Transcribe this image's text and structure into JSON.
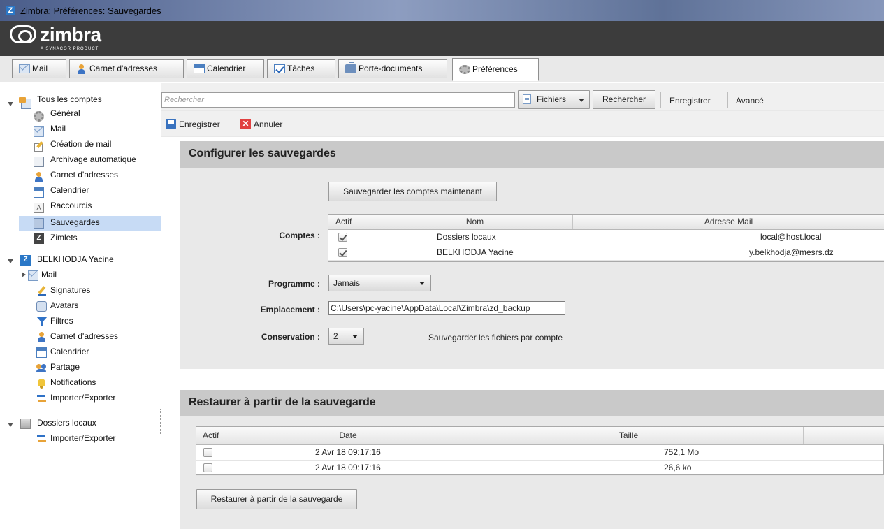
{
  "window": {
    "title": "Zimbra: Préférences: Sauvegardes"
  },
  "brand": {
    "name": "zimbra",
    "tagline": "A SYNACOR PRODUCT"
  },
  "tabs": [
    {
      "label": "Mail",
      "icon": "mail-icon"
    },
    {
      "label": "Carnet d'adresses",
      "icon": "contacts-icon"
    },
    {
      "label": "Calendrier",
      "icon": "calendar-icon"
    },
    {
      "label": "Tâches",
      "icon": "tasks-icon"
    },
    {
      "label": "Porte-documents",
      "icon": "briefcase-icon"
    },
    {
      "label": "Préférences",
      "icon": "gear-icon",
      "active": true
    }
  ],
  "sidebar": {
    "all_accounts": {
      "label": "Tous les comptes",
      "items": [
        {
          "label": "Général",
          "icon": "gear-icon"
        },
        {
          "label": "Mail",
          "icon": "mail-icon"
        },
        {
          "label": "Création de mail",
          "icon": "compose-icon"
        },
        {
          "label": "Archivage automatique",
          "icon": "archive-icon"
        },
        {
          "label": "Carnet d'adresses",
          "icon": "contacts-icon"
        },
        {
          "label": "Calendrier",
          "icon": "calendar-icon"
        },
        {
          "label": "Raccourcis",
          "icon": "shortcut-icon"
        },
        {
          "label": "Sauvegardes",
          "icon": "backup-icon",
          "selected": true
        },
        {
          "label": "Zimlets",
          "icon": "zimlet-icon"
        }
      ]
    },
    "user_account": {
      "label": "BELKHODJA Yacine",
      "items": [
        {
          "label": "Mail",
          "icon": "mail-icon"
        },
        {
          "label": "Signatures",
          "icon": "signature-icon"
        },
        {
          "label": "Avatars",
          "icon": "avatar-icon"
        },
        {
          "label": "Filtres",
          "icon": "filter-icon"
        },
        {
          "label": "Carnet d'adresses",
          "icon": "contacts-icon"
        },
        {
          "label": "Calendrier",
          "icon": "calendar-icon"
        },
        {
          "label": "Partage",
          "icon": "share-icon"
        },
        {
          "label": "Notifications",
          "icon": "bell-icon"
        },
        {
          "label": "Importer/Exporter",
          "icon": "import-export-icon"
        }
      ]
    },
    "local_folders": {
      "label": "Dossiers locaux",
      "items": [
        {
          "label": "Importer/Exporter",
          "icon": "import-export-icon"
        }
      ]
    }
  },
  "search": {
    "placeholder": "Rechercher",
    "files_label": "Fichiers",
    "search_button": "Rechercher",
    "save_link": "Enregistrer",
    "advanced_link": "Avancé"
  },
  "toolbar": {
    "save_label": "Enregistrer",
    "cancel_label": "Annuler"
  },
  "backup_config": {
    "heading": "Configurer les sauvegardes",
    "backup_now_button": "Sauvegarder les comptes maintenant",
    "accounts_label": "Comptes :",
    "columns": [
      "Actif",
      "Nom",
      "Adresse Mail"
    ],
    "accounts": [
      {
        "active": true,
        "name": "Dossiers locaux",
        "email": "local@host.local"
      },
      {
        "active": true,
        "name": "BELKHODJA Yacine",
        "email": "y.belkhodja@mesrs.dz"
      }
    ],
    "schedule_label": "Programme :",
    "schedule_value": "Jamais",
    "location_label": "Emplacement :",
    "location_value": "C:\\Users\\pc-yacine\\AppData\\Local\\Zimbra\\zd_backup",
    "retention_label": "Conservation :",
    "retention_value": "2",
    "retention_note": "Sauvegarder les fichiers par compte"
  },
  "restore": {
    "heading": "Restaurer à partir de la sauvegarde",
    "columns": [
      "Actif",
      "Date",
      "Taille"
    ],
    "rows": [
      {
        "active": false,
        "date": "2 Avr 18 09:17:16",
        "size": "752,1 Mo"
      },
      {
        "active": false,
        "date": "2 Avr 18 09:17:16",
        "size": "26,6 ko"
      }
    ],
    "restore_button": "Restaurer à partir de la sauvegarde"
  }
}
